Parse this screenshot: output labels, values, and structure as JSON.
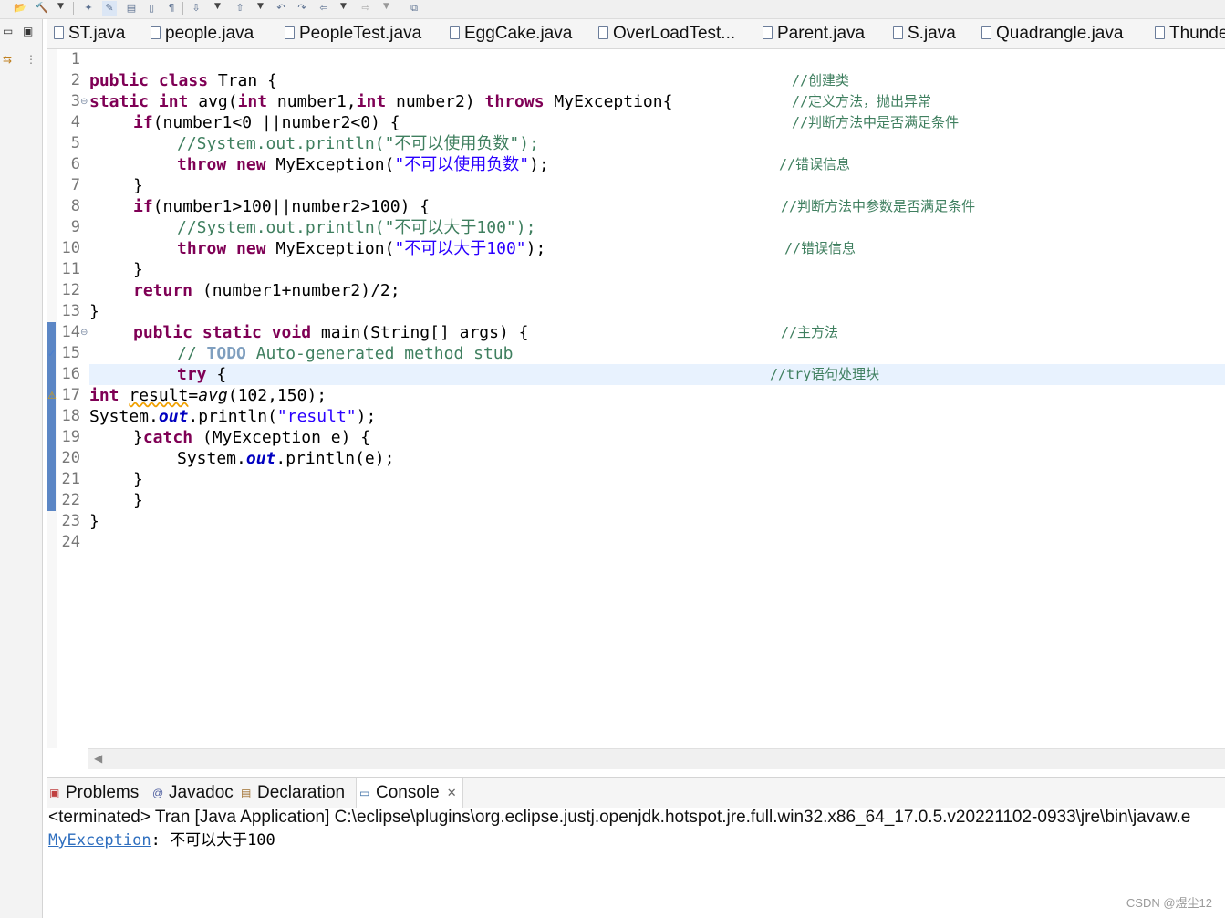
{
  "toolbar": {
    "icons": [
      "open-icon",
      "build-icon",
      "dropdown",
      "debug-icon",
      "highlight-icon",
      "toggle-icon",
      "pilcrow-icon",
      "next-annotation-icon",
      "prev-annotation-icon",
      "back-icon",
      "forward-icon",
      "open-perspective-icon"
    ],
    "pilcrow": "¶"
  },
  "editor_tabs": [
    {
      "label": "ST.java"
    },
    {
      "label": "people.java"
    },
    {
      "label": "PeopleTest.java"
    },
    {
      "label": "EggCake.java"
    },
    {
      "label": "OverLoadTest..."
    },
    {
      "label": "Parent.java"
    },
    {
      "label": "S.java"
    },
    {
      "label": "Quadrangle.java"
    },
    {
      "label": "Thunde"
    }
  ],
  "line_numbers": [
    "1",
    "2",
    "3",
    "4",
    "5",
    "6",
    "7",
    "8",
    "9",
    "10",
    "11",
    "12",
    "13",
    "14",
    "15",
    "16",
    "17",
    "18",
    "19",
    "20",
    "21",
    "22",
    "23",
    "24"
  ],
  "code": {
    "l2_kw": "public class",
    "l2_rest": " Tran {",
    "l3_kw1": "static",
    "l3_kw2": "int",
    "l3_a": " avg(",
    "l3_kw3": "int",
    "l3_b": " number1,",
    "l3_kw4": "int",
    "l3_c": " number2) ",
    "l3_kw5": "throws",
    "l3_d": " MyException{",
    "l4_kw": "if",
    "l4_rest": "(number1<0 ||number2<0) {",
    "l5": "//System.out.println(\"不可以使用负数\");",
    "l6_kw": "throw new",
    "l6_a": " MyException(",
    "l6_str": "\"不可以使用负数\"",
    "l6_b": ");",
    "l7": "}",
    "l8_kw": "if",
    "l8_rest": "(number1>100||number2>100) {",
    "l9": "//System.out.println(\"不可以大于100\");",
    "l10_kw": "throw new",
    "l10_a": " MyException(",
    "l10_str": "\"不可以大于100\"",
    "l10_b": ");",
    "l11": "}",
    "l12_kw": "return",
    "l12_rest": " (number1+number2)/2;",
    "l13": "}",
    "l14_kw": "public static void",
    "l14_rest": " main(String[] args) {",
    "l15_a": "// ",
    "l15_todo": "TODO",
    "l15_b": " Auto-generated method stub",
    "l16_kw": "try",
    "l16_rest": " {",
    "l17_kw": "int",
    "l17_var": "result",
    "l17_a": "=",
    "l17_call": "avg",
    "l17_b": "(102,150);",
    "l18_a": "System.",
    "l18_fld": "out",
    "l18_b": ".println(",
    "l18_str": "\"result\"",
    "l18_c": ");",
    "l19_a": "}",
    "l19_kw": "catch",
    "l19_b": " (MyException e) {",
    "l20_a": "System.",
    "l20_fld": "out",
    "l20_b": ".println(e);",
    "l21": "}",
    "l22": "}",
    "l23": "}"
  },
  "comments": {
    "c2": "//创建类",
    "c3": "//定义方法，抛出异常",
    "c4": "//判断方法中是否满足条件",
    "c6": "//错误信息",
    "c8": "//判断方法中参数是否满足条件",
    "c10": "//错误信息",
    "c14": "//主方法",
    "c16": "//try语句处理块"
  },
  "bottom_tabs": [
    {
      "label": "Problems",
      "icon": "problems-icon"
    },
    {
      "label": "Javadoc",
      "icon": "javadoc-icon"
    },
    {
      "label": "Declaration",
      "icon": "declaration-icon"
    },
    {
      "label": "Console",
      "icon": "console-icon",
      "active": true,
      "close": "✕"
    }
  ],
  "console": {
    "header": "<terminated> Tran [Java Application] C:\\eclipse\\plugins\\org.eclipse.justj.openjdk.hotspot.jre.full.win32.x86_64_17.0.5.v20221102-0933\\jre\\bin\\javaw.e",
    "exception_link": "MyException",
    "message": ": 不可以大于100"
  },
  "watermark": "CSDN @煜尘12",
  "colors": {
    "keyword": "#7f0055",
    "string": "#2a00ff",
    "comment": "#3f7f5f",
    "field": "#0000c0",
    "current_line": "#e8f2fe"
  }
}
